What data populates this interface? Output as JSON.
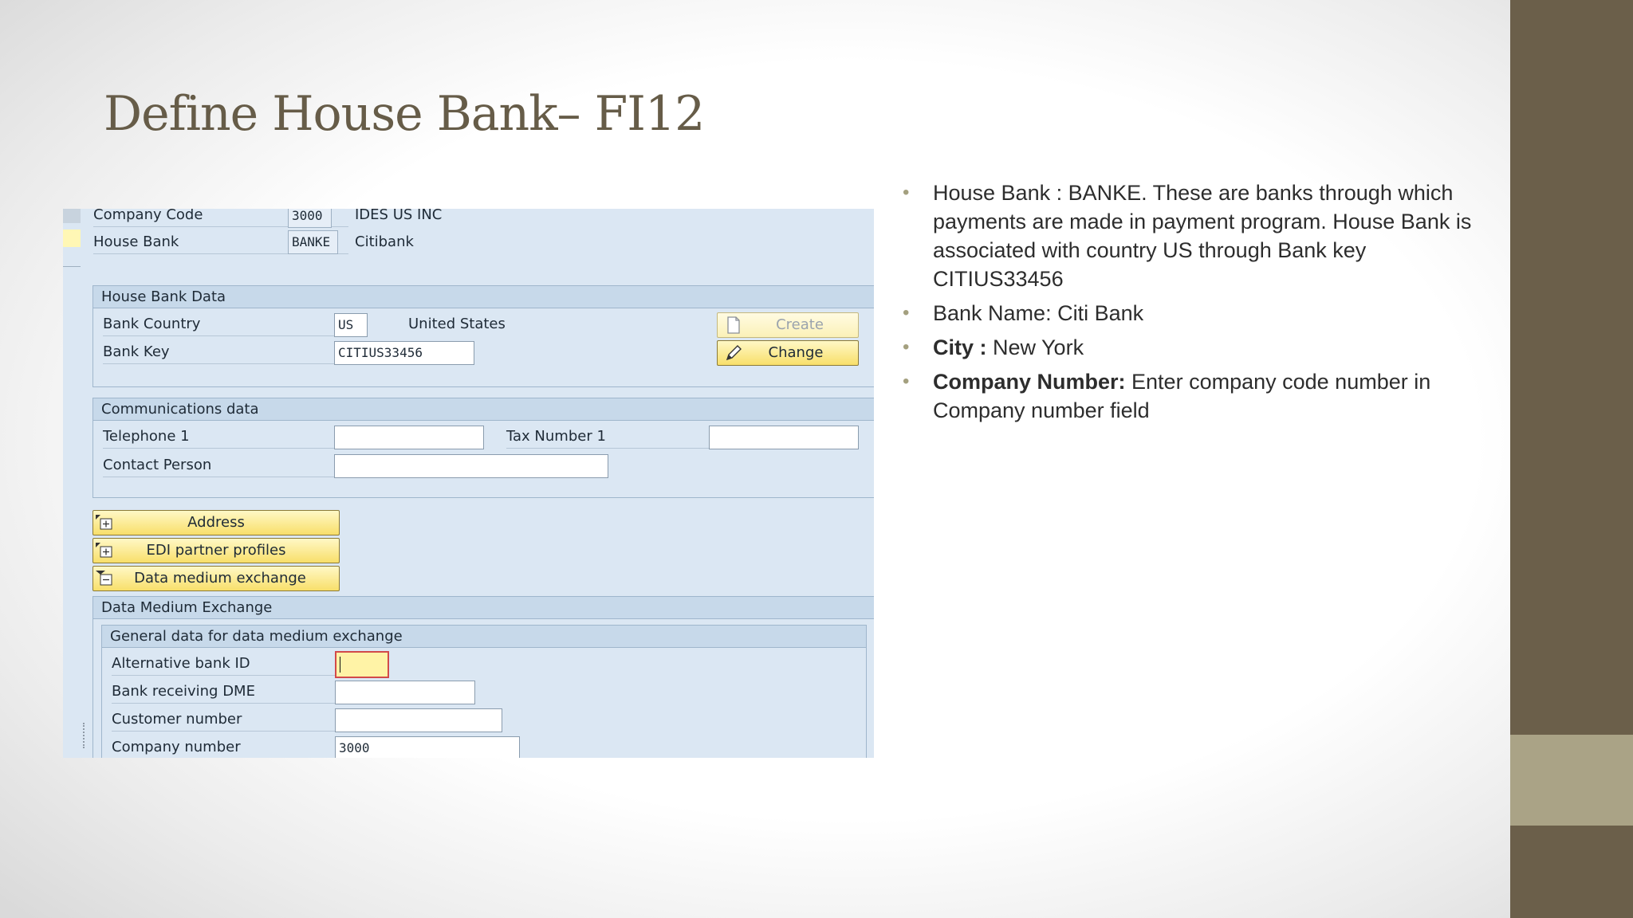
{
  "slide": {
    "title": "Define House Bank– FI12",
    "colors": {
      "title": "#665c48",
      "side_band": "#6b5f4a",
      "side_accent": "#aaa386",
      "bullet": "#a4a07f"
    }
  },
  "header": {
    "company_code_label": "Company Code",
    "company_code_value": "3000",
    "company_name": "IDES US INC",
    "house_bank_label": "House Bank",
    "house_bank_value": "BANKE",
    "house_bank_name": "Citibank"
  },
  "house_bank_data": {
    "title": "House Bank Data",
    "bank_country_label": "Bank Country",
    "bank_country_value": "US",
    "bank_country_name": "United States",
    "bank_key_label": "Bank Key",
    "bank_key_value": "CITIUS33456",
    "create_label": "Create",
    "change_label": "Change"
  },
  "communications": {
    "title": "Communications data",
    "telephone_label": "Telephone 1",
    "telephone_value": "",
    "tax_number_label": "Tax Number 1",
    "tax_number_value": "",
    "contact_person_label": "Contact Person",
    "contact_person_value": ""
  },
  "tree_buttons": {
    "address": "Address",
    "edi": "EDI partner profiles",
    "dme": "Data medium exchange"
  },
  "dme": {
    "title": "Data Medium Exchange",
    "general_title": "General data for data medium exchange",
    "alt_bank_id_label": "Alternative bank ID",
    "alt_bank_id_value": "",
    "bank_receiving_label": "Bank receiving DME",
    "bank_receiving_value": "",
    "customer_number_label": "Customer number",
    "customer_number_value": "",
    "company_number_label": "Company number",
    "company_number_value": "3000"
  },
  "bullets": {
    "b1": "House Bank : BANKE. These are banks through which payments are made in payment program. House Bank is associated with country US through Bank key CITIUS33456",
    "b2": "Bank Name:  Citi Bank",
    "b3_label": "City :",
    "b3_text": " New York",
    "b4_label": "Company Number:",
    "b4_text": " Enter company code number in Company number field"
  }
}
